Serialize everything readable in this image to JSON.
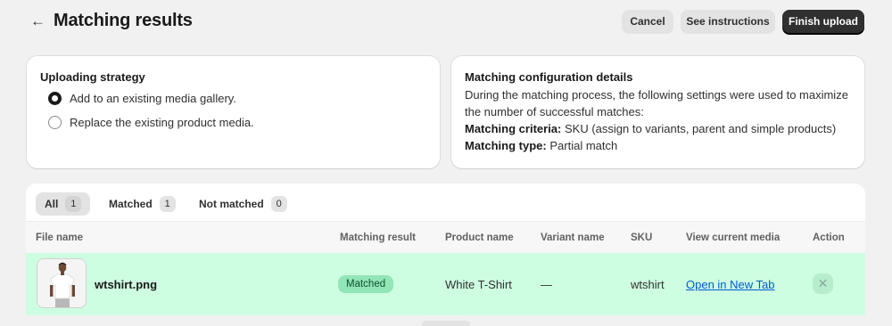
{
  "header": {
    "title": "Matching results",
    "cancel_label": "Cancel",
    "instructions_label": "See instructions",
    "finish_label": "Finish upload"
  },
  "strategy": {
    "title": "Uploading strategy",
    "options": [
      {
        "label": "Add to an existing media gallery.",
        "selected": true
      },
      {
        "label": "Replace the existing product media.",
        "selected": false
      }
    ]
  },
  "config": {
    "title": "Matching configuration details",
    "description": "During the matching process, the following settings were used to maximize the number of successful matches:",
    "criteria_label": "Matching criteria:",
    "criteria_value": "SKU (assign to variants, parent and simple products)",
    "type_label": "Matching type:",
    "type_value": "Partial match"
  },
  "tabs": [
    {
      "label": "All",
      "count": "1",
      "active": true
    },
    {
      "label": "Matched",
      "count": "1",
      "active": false
    },
    {
      "label": "Not matched",
      "count": "0",
      "active": false
    }
  ],
  "table": {
    "columns": [
      "File name",
      "Matching result",
      "Product name",
      "Variant name",
      "SKU",
      "View current media",
      "Action"
    ],
    "rows": [
      {
        "file_name": "wtshirt.png",
        "matching_result": "Matched",
        "product_name": "White T-Shirt",
        "variant_name": "—",
        "sku": "wtshirt",
        "view_media": "Open in New Tab",
        "action_icon": "close-icon"
      }
    ]
  },
  "colors": {
    "primary_button": "#303030",
    "matched_row": "#cdfee1",
    "matched_badge": "#92e5b6",
    "link": "#005bd3"
  }
}
